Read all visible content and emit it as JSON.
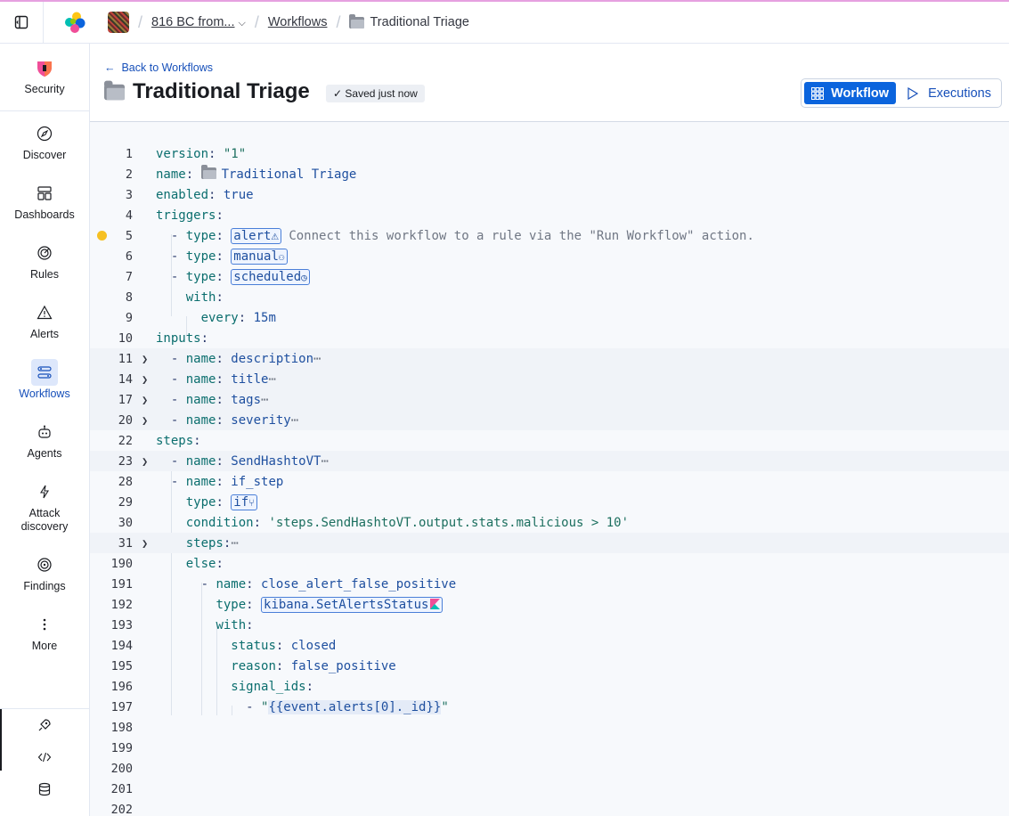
{
  "topbar": {
    "breadcrumbs": {
      "space": "816 BC from...",
      "workflows": "Workflows",
      "current": "Traditional Triage"
    }
  },
  "sidebar": {
    "brand": "Security",
    "items": [
      {
        "label": "Discover",
        "icon": "compass-icon"
      },
      {
        "label": "Dashboards",
        "icon": "dashboard-icon"
      },
      {
        "label": "Rules",
        "icon": "rules-icon"
      },
      {
        "label": "Alerts",
        "icon": "alert-triangle-icon"
      },
      {
        "label": "Workflows",
        "icon": "workflows-icon",
        "active": true
      },
      {
        "label": "Agents",
        "icon": "robot-icon"
      },
      {
        "label": "Attack discovery",
        "icon": "bolt-icon"
      },
      {
        "label": "Findings",
        "icon": "target-icon"
      },
      {
        "label": "More",
        "icon": "more-vertical-icon"
      }
    ]
  },
  "header": {
    "back": "Back to Workflows",
    "title": "Traditional Triage",
    "saved": "Saved just now",
    "view_workflow": "Workflow",
    "view_executions": "Executions"
  },
  "editor": {
    "lines": {
      "l1": "1",
      "l2": "2",
      "l3": "3",
      "l4": "4",
      "l5": "5",
      "l6": "6",
      "l7": "7",
      "l8": "8",
      "l9": "9",
      "l10": "10",
      "l11": "11",
      "l14": "14",
      "l17": "17",
      "l20": "20",
      "l22": "22",
      "l23": "23",
      "l28": "28",
      "l29": "29",
      "l30": "30",
      "l31": "31",
      "l190": "190",
      "l191": "191",
      "l192": "192",
      "l193": "193",
      "l194": "194",
      "l195": "195",
      "l196": "196",
      "l197": "197",
      "l198": "198",
      "l199": "199",
      "l200": "200",
      "l201": "201",
      "l202": "202"
    },
    "version_key": "version",
    "version_val": "\"1\"",
    "name_key": "name",
    "name_val": "Traditional Triage",
    "enabled_key": "enabled",
    "enabled_val": "true",
    "triggers_key": "triggers",
    "type_key": "type",
    "trig_alert": "alert",
    "trig_alert_hint": "Connect this workflow to a rule via the \"Run Workflow\" action.",
    "trig_manual": "manual",
    "trig_scheduled": "scheduled",
    "with_key": "with",
    "every_key": "every",
    "every_val": "15m",
    "inputs_key": "inputs",
    "input_description": "description",
    "input_title": "title",
    "input_tags": "tags",
    "input_severity": "severity",
    "steps_key": "steps",
    "step1_name": "SendHashtoVT",
    "step2_name": "if_step",
    "step2_type": "if",
    "condition_key": "condition",
    "condition_val": "'steps.SendHashtoVT.output.stats.malicious > 10'",
    "else_key": "else",
    "else_name": "close_alert_false_positive",
    "else_type": "kibana.SetAlertsStatus",
    "status_key": "status",
    "status_val": "closed",
    "reason_key": "reason",
    "reason_val": "false_positive",
    "signal_ids_key": "signal_ids",
    "signal_val": "{{event.alerts[0]._id}}"
  }
}
